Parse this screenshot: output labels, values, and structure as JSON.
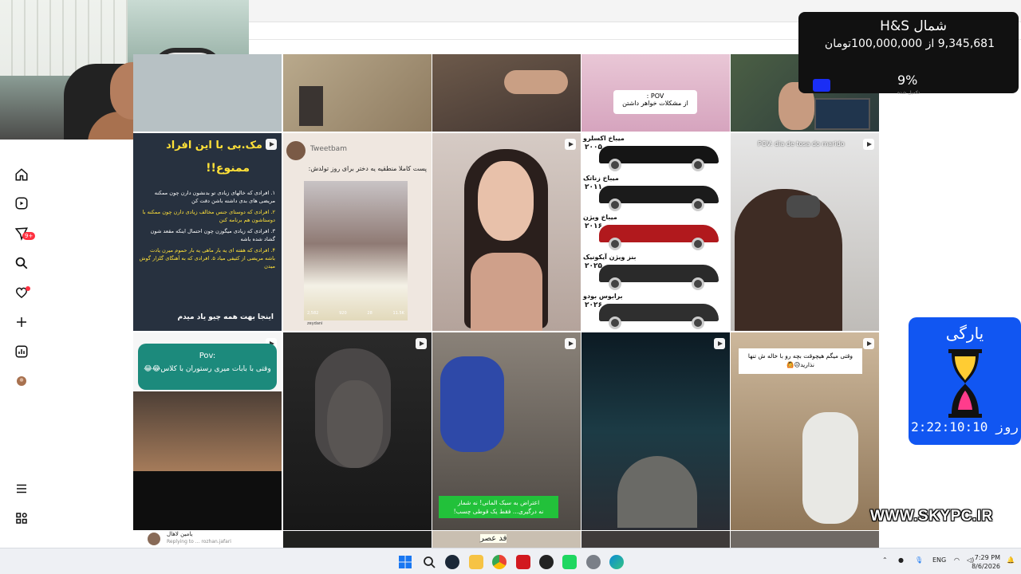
{
  "donation": {
    "title": "H&S شمال",
    "progress_text": "9,345,681 از 100,000,000تومان",
    "percent_label": "9%",
    "percent_value": 9,
    "sub_label": "تکمیل شده",
    "bar_color": "#1a2ef5"
  },
  "countdown": {
    "title": "یارگی",
    "time": "2:22:10:10 روز"
  },
  "watermark": "WWW.SKYPC.IR",
  "sidebar": {
    "items": [
      {
        "icon": "home-icon"
      },
      {
        "icon": "reels-icon"
      },
      {
        "icon": "messages-icon"
      },
      {
        "icon": "search-icon"
      },
      {
        "icon": "notifications-icon"
      },
      {
        "icon": "create-icon"
      },
      {
        "icon": "dashboard-icon"
      },
      {
        "icon": "profile-avatar"
      }
    ],
    "badge": "9+",
    "more_icon": "menu-icon",
    "meta_icon": "meta-icon"
  },
  "tiles": {
    "t5_caption": "POV :\nاز مشکلات خواهر داشتن",
    "t6_header": "مک.بی با این افراد",
    "t6_sub": "ممنوع!!",
    "t6_lines": [
      "۱. افرادی که خالهای زیادی تو بدنشون دارن چون ممکنه مریضی های بدی داشته باشن دقت کن",
      "۲. افرادی که دوستای جنس مخالف زیادی دارن چون ممکنه با دوستاشون هم برنامه کنن",
      "۳. افرادی که زیادی میگوزن چون احتمال اینکه مقعد شون گشاد شده باشه",
      "۴. افرادی که هفته ای یه بار ماهی یه بار حموم میرن یادت باشه مریضی از کثیفی میاد ۵. افرادی که به آهنگای گلزار گوش میدن"
    ],
    "t6_footer": "اینجا بهت همه چیو یاد میدم",
    "t7_user": "Tweetbam",
    "t7_text": "پست کاملا منطقیه یه دختر برای روز تولدش:",
    "t7_stats": [
      "2,582",
      "920",
      "28",
      "11.5K"
    ],
    "t7_foot": "zeydani",
    "t9_cars": [
      {
        "label": "میباخ اکسلرو",
        "year": "۲۰۰۵"
      },
      {
        "label": "میباخ زناتک",
        "year": "۲۰۱۱"
      },
      {
        "label": "میباخ ویژن",
        "year": "۲۰۱۶"
      },
      {
        "label": "بنز ویژن آیکونیک",
        "year": "۲۰۲۵"
      },
      {
        "label": "برابوس بودو",
        "year": "۲۰۲۶"
      }
    ],
    "t10_caption": "POV: dia de tosa do marido",
    "t11_title": "Pov:",
    "t11_text": "وقتی با بابات میری رستوران با کلاس😂😂",
    "t13_caption": "اعتراض به سبک المانی! نه شمار\nنه درگیری... فقط یک قوطی چسب!",
    "t15_caption": "وقتی میگم هیچوقت بچه رو با خاله ش تنها نذارید😥🙆",
    "t16_user": "یامین لاهال",
    "t16_reply": "Replying to ... rozhan.jafari",
    "t18_text": "فد عصر"
  },
  "taskbar": {
    "lang": "ENG",
    "time": "7:29 PM",
    "date": "8/6/2026",
    "app_icons": [
      "start-icon",
      "search-icon",
      "steam-icon",
      "file-explorer-icon",
      "chrome-icon",
      "youtube-icon",
      "obs-icon",
      "spotify-icon",
      "settings-icon",
      "edge-icon"
    ]
  },
  "colors": {
    "accent_blue": "#1156f2",
    "notification_red": "#ff3040",
    "donation_bg": "#111111"
  }
}
